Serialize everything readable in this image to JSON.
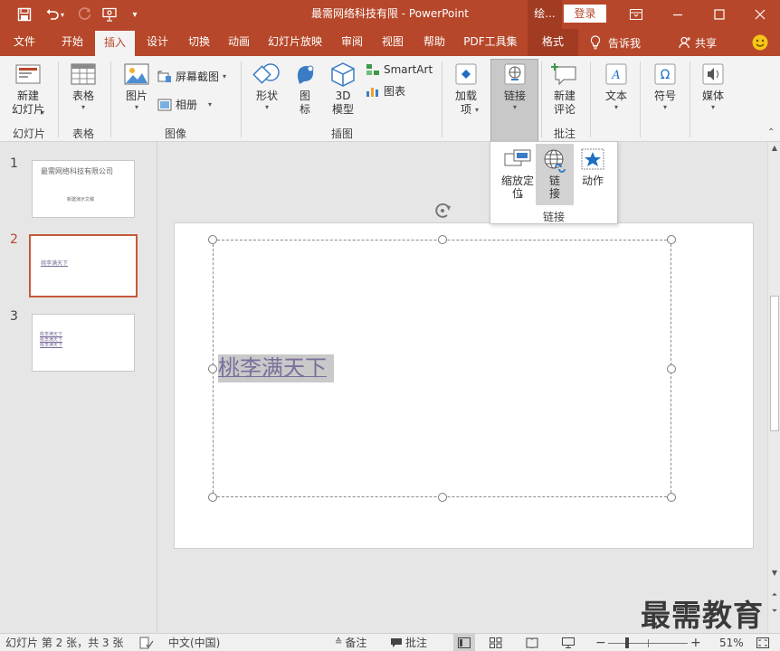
{
  "window": {
    "title": "最需网络科技有限  -  PowerPoint",
    "context_tab": "绘...",
    "login_label": "登录"
  },
  "tabs": [
    {
      "label": "文件"
    },
    {
      "label": "开始"
    },
    {
      "label": "插入"
    },
    {
      "label": "设计"
    },
    {
      "label": "切换"
    },
    {
      "label": "动画"
    },
    {
      "label": "幻灯片放映"
    },
    {
      "label": "审阅"
    },
    {
      "label": "视图"
    },
    {
      "label": "帮助"
    },
    {
      "label": "PDF工具集"
    },
    {
      "label": "格式"
    }
  ],
  "tellme": "告诉我",
  "share": "共享",
  "ribbon": {
    "new_slide": [
      "新建",
      "幻灯片"
    ],
    "table": "表格",
    "picture": "图片",
    "screenshot": "屏幕截图",
    "album": "相册",
    "shapes": "形状",
    "icons": [
      "图",
      "标"
    ],
    "model3d": [
      "3D",
      "模型"
    ],
    "smartart": "SmartArt",
    "chart": "图表",
    "addins": [
      "加载",
      "项"
    ],
    "link": "链接",
    "new_comment": [
      "新建",
      "评论"
    ],
    "text": "文本",
    "symbol": "符号",
    "media": "媒体",
    "groups": {
      "slides": "幻灯片",
      "tables": "表格",
      "images": "图像",
      "illustrations": "插图",
      "comments": "批注"
    }
  },
  "link_dropdown": {
    "zoom": [
      "缩放定",
      "位"
    ],
    "link": [
      "链",
      "接"
    ],
    "action": "动作",
    "group_label": "链接"
  },
  "thumbnails": [
    {
      "num": "1",
      "title": "最需网络科技有限公司",
      "subtitle": "新建演示文稿"
    },
    {
      "num": "2",
      "text": "桃李满天下"
    },
    {
      "num": "3",
      "lines": [
        "桃李满天下",
        "桃李满天下",
        "桃李满天下"
      ]
    }
  ],
  "slide": {
    "text": "桃李满天下"
  },
  "status": {
    "slide_info": "幻灯片 第 2 张，共 3 张",
    "language": "中文(中国)",
    "notes": "备注",
    "comments": "批注",
    "zoom": "51%"
  },
  "watermark": "最需教育",
  "colors": {
    "accent": "#b7472a",
    "link_text": "#7c6e9a"
  }
}
